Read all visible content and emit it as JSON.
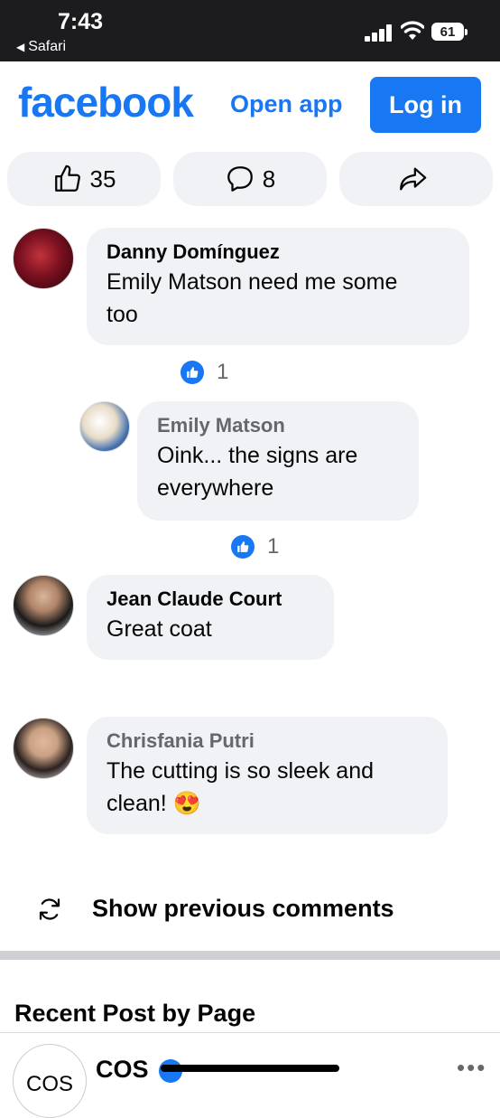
{
  "status_bar": {
    "time": "7:43",
    "back_app": "Safari",
    "battery": "61"
  },
  "header": {
    "logo": "facebook",
    "open_app": "Open app",
    "login": "Log in"
  },
  "reactions": {
    "likes": "35",
    "comments": "8",
    "like_icon": "thumbs-up-icon",
    "comment_icon": "comment-bubble-icon",
    "share_icon": "share-arrow-icon"
  },
  "comments": [
    {
      "author": "Danny Domínguez",
      "text_line1": "Emily Matson need me some",
      "text_line2": "too",
      "likes": "1"
    },
    {
      "author": "Emily Matson",
      "text_line1": "Oink... the signs are",
      "text_line2": "everywhere",
      "likes": "1"
    },
    {
      "author": "Jean Claude Court",
      "text_line1": "Great coat"
    },
    {
      "author": "Chrisfania Putri",
      "text_line1": "The cutting is so sleek and",
      "text_line2": "clean!",
      "emoji": "😍"
    }
  ],
  "show_previous": "Show previous comments",
  "recent_post": {
    "heading": "Recent Post by Page",
    "page_name": "COS",
    "avatar_text": "COS",
    "more": "•••"
  },
  "colors": {
    "brand": "#1877f2",
    "bubble": "#f0f2f5"
  }
}
